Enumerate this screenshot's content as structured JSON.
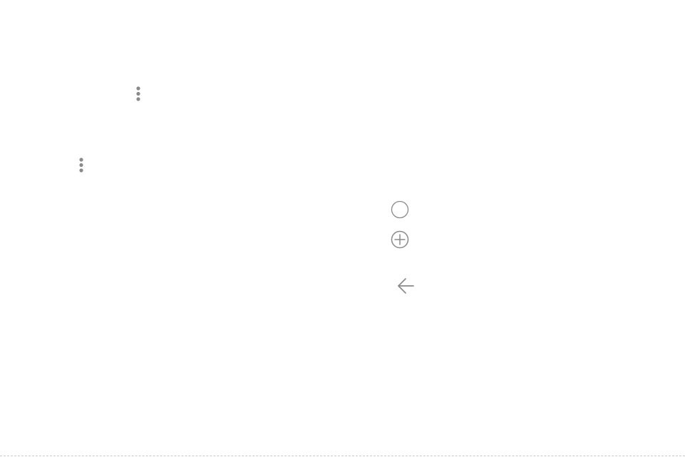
{
  "icons": {
    "more_options_1": "more-vertical-icon",
    "more_options_2": "more-vertical-icon",
    "home": "circle-icon",
    "add": "add-circle-icon",
    "back": "back-arrow-icon"
  },
  "colors": {
    "icon_gray": "#8a8a8a",
    "background": "#ffffff"
  }
}
